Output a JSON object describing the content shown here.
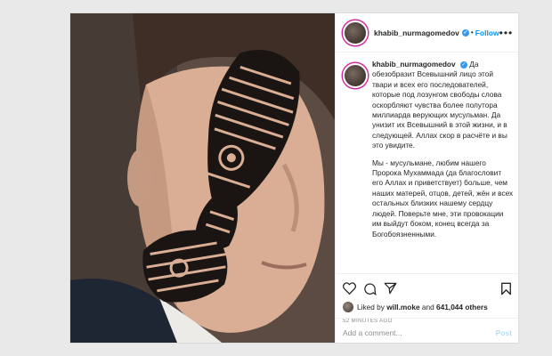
{
  "header": {
    "username": "khabib_nurmagomedov",
    "follow_label": "Follow",
    "separator": "•",
    "more_label": "•••"
  },
  "caption": {
    "username": "khabib_nurmagomedov",
    "paragraph1": "Да обезобразит Всевышний лицо этой твари и всех его последователей, которые под лозунгом свободы слова оскорбляют чувства более полутора миллиарда верующих мусульман. Да унизит их Всевышний в этой жизни, и в следующей. Аллах скор в расчёте и вы это увидите.",
    "paragraph2": "Мы - мусульмане, любим нашего Пророка Мухаммада (да благословит его Аллах и приветствует) больше, чем наших матерей, отцов, детей, жён и всех остальных близких нашему сердцу людей. Поверьте мне, эти провокации им выйдут боком, конец всегда за Богобоязненными."
  },
  "likes": {
    "prefix": "Liked by",
    "user": "will.moke",
    "and": "and",
    "count": "641,044 others"
  },
  "timestamp": "52 MINUTES AGO",
  "comment": {
    "placeholder": "Add a comment...",
    "post_label": "Post"
  },
  "icons": [
    "heart-icon",
    "comment-icon",
    "share-icon",
    "bookmark-icon",
    "verified-badge-icon"
  ],
  "colors": {
    "link_blue": "#0095f6",
    "post_disabled": "#b2dffc",
    "verified": "#3897f0"
  }
}
